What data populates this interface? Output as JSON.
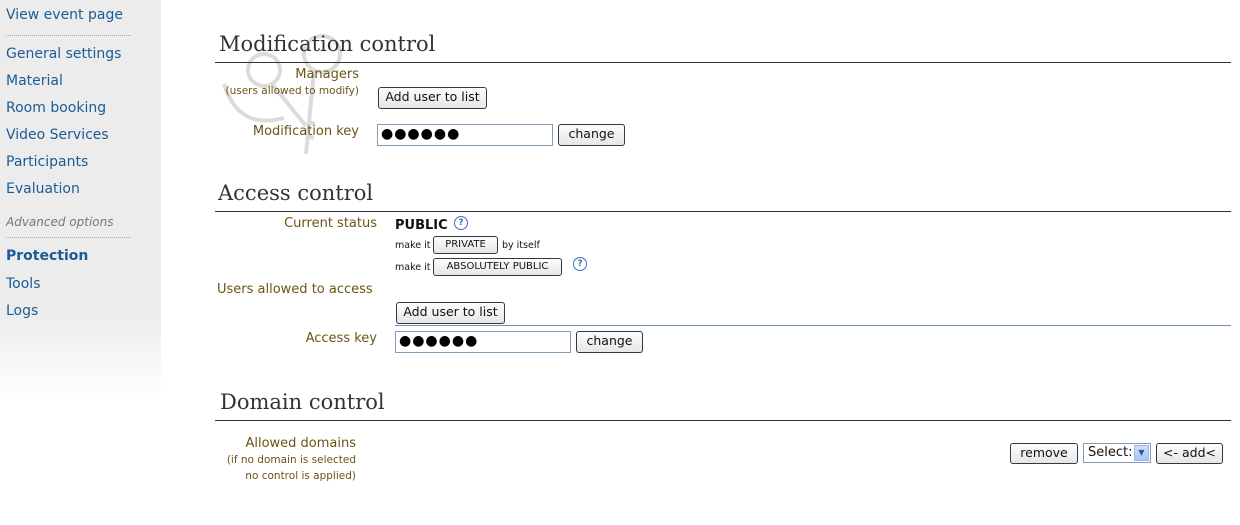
{
  "sidebar": {
    "view_event": "View event page",
    "items": [
      {
        "label": "General settings"
      },
      {
        "label": "Material"
      },
      {
        "label": "Room booking"
      },
      {
        "label": "Video Services"
      },
      {
        "label": "Participants"
      },
      {
        "label": "Evaluation"
      }
    ],
    "advanced_section": "Advanced options",
    "advanced_items": [
      {
        "label": "Protection",
        "selected": true
      },
      {
        "label": "Tools"
      },
      {
        "label": "Logs"
      }
    ]
  },
  "modification": {
    "title": "Modification control",
    "managers_label": "Managers",
    "managers_sub": "(users allowed to modify)",
    "add_user_label": "Add user to list",
    "key_label": "Modification key",
    "key_value": "●●●●●●",
    "change_label": "change"
  },
  "access": {
    "title": "Access control",
    "status_label": "Current status",
    "status_value": "PUBLIC",
    "make_it": "make it",
    "private_label": "PRIVATE",
    "by_itself": "by itself",
    "absolutely_public_label": "ABSOLUTELY PUBLIC",
    "users_label": "Users allowed to access",
    "add_user_label": "Add user to list",
    "key_label": "Access key",
    "key_value": "●●●●●●",
    "change_label": "change",
    "help_glyph": "?"
  },
  "domain": {
    "title": "Domain control",
    "allowed_label": "Allowed domains",
    "allowed_sub1": "(if no domain is selected",
    "allowed_sub2": "no control is applied)",
    "remove_label": "remove",
    "select_value": "Select:",
    "add_label": "<- add<"
  },
  "colors": {
    "link": "#1a5c96",
    "label": "#6b5516",
    "sidebar_bg": "#ececec"
  }
}
